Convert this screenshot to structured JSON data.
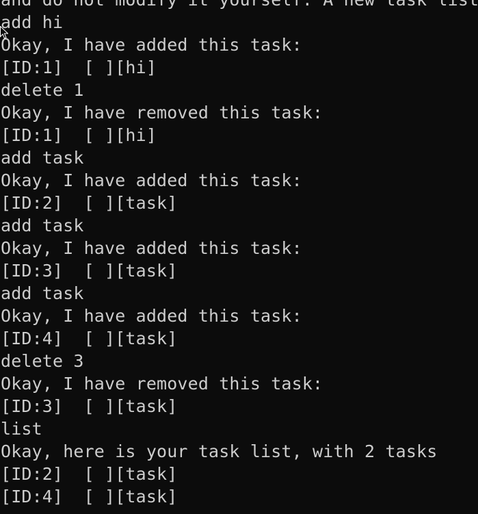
{
  "terminal": {
    "lines": [
      "and do not modify it yourself. A new task list",
      "add hi",
      "Okay, I have added this task:",
      "[ID:1]  [ ][hi]",
      "delete 1",
      "Okay, I have removed this task:",
      "[ID:1]  [ ][hi]",
      "add task",
      "Okay, I have added this task:",
      "[ID:2]  [ ][task]",
      "add task",
      "Okay, I have added this task:",
      "[ID:3]  [ ][task]",
      "add task",
      "Okay, I have added this task:",
      "[ID:4]  [ ][task]",
      "delete 3",
      "Okay, I have removed this task:",
      "[ID:3]  [ ][task]",
      "list",
      "Okay, here is your task list, with 2 tasks",
      "[ID:2]  [ ][task]",
      "[ID:4]  [ ][task]"
    ]
  },
  "colors": {
    "background": "#0c0c0c",
    "text": "#cccccc"
  }
}
